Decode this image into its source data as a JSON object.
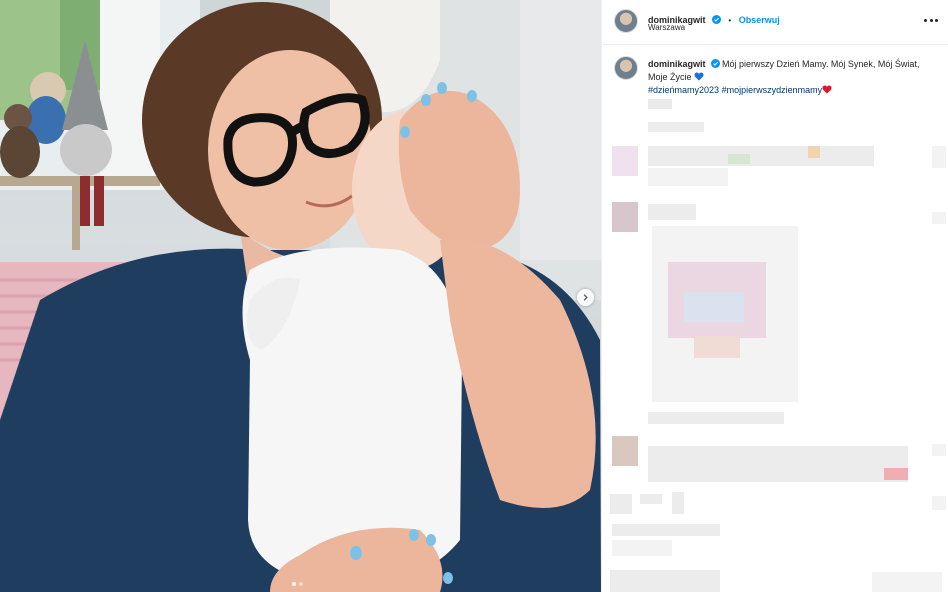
{
  "post": {
    "username": "dominikagwit",
    "location": "Warszawa",
    "follow_label": "Obserwuj",
    "separator": "•",
    "caption_text": "Mój pierwszy Dzień Mamy. Mój Synek, Mój Świat, Moje Życie",
    "hashtags": [
      "#dzieńmamy2023",
      "#mojpierwszydzienmamy"
    ]
  },
  "icons": {
    "verified": "verified-badge-icon",
    "more": "more-options-icon",
    "next": "chevron-right-icon",
    "heart_blue": "blue-heart-emoji",
    "heart_red": "red-heart-emoji"
  },
  "colors": {
    "accent": "#0095f6",
    "hashtag": "#00376b",
    "text": "#262626",
    "border": "#efefef"
  },
  "carousel": {
    "slides": 2,
    "active": 1
  }
}
